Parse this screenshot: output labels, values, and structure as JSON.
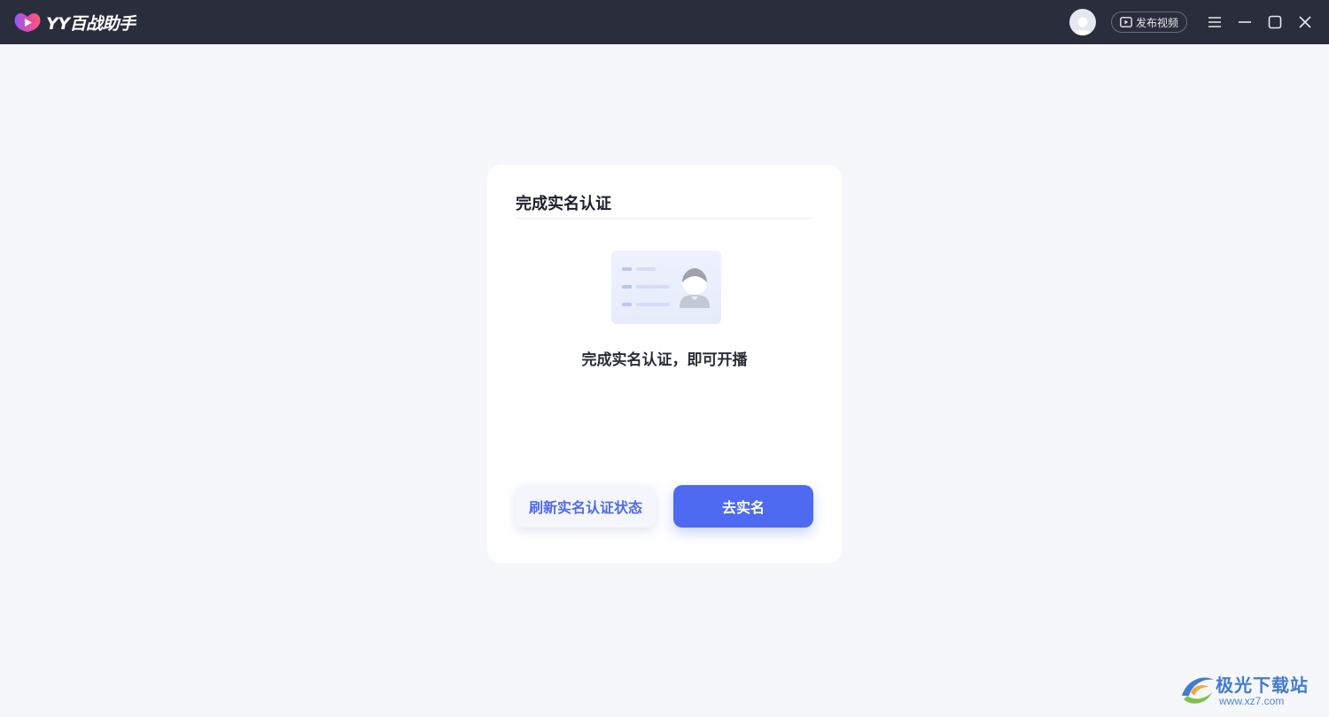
{
  "app": {
    "name": "YY百战助手"
  },
  "titlebar": {
    "publish_label": "发布视频"
  },
  "card": {
    "title": "完成实名认证",
    "message": "完成实名认证，即可开播",
    "refresh_label": "刷新实名认证状态",
    "go_label": "去实名"
  },
  "watermark": {
    "name": "极光下载站",
    "url": "www.xz7.com"
  },
  "colors": {
    "titlebar_bg": "#2a2d3b",
    "page_bg": "#f6f7fb",
    "accent": "#4d6af0"
  }
}
